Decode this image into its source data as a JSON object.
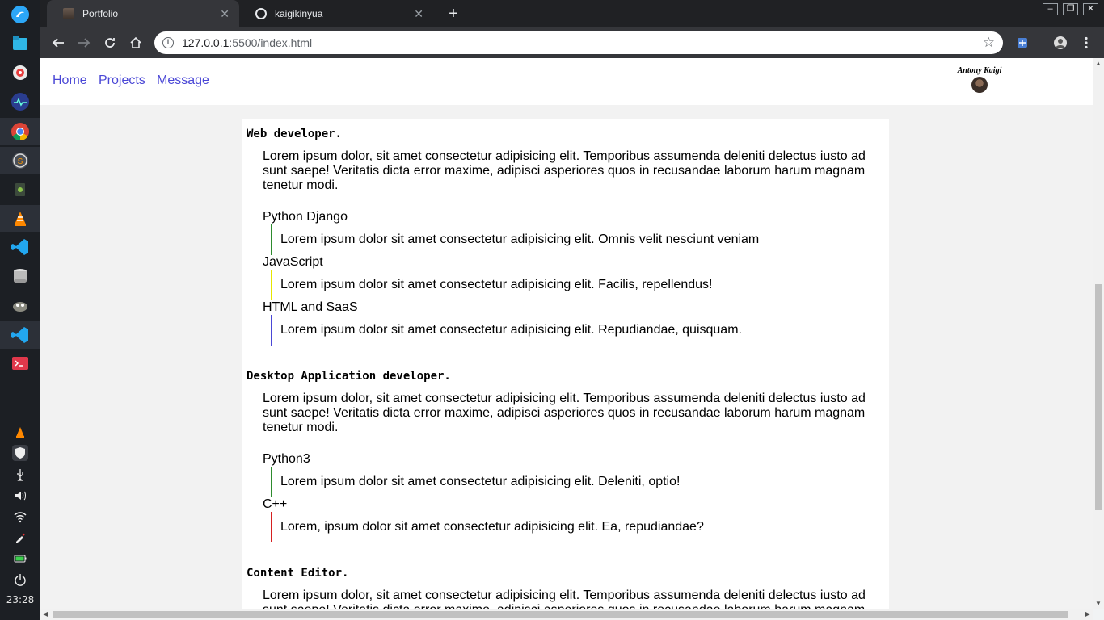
{
  "dock": {
    "apps": [
      "deepin-launcher-icon",
      "file-manager-icon",
      "settings-icon",
      "system-monitor-icon",
      "chrome-icon",
      "sublime-icon",
      "trash-icon",
      "vlc-icon",
      "vscode-icon",
      "database-icon",
      "gimp-icon",
      "vscode-icon-2",
      "terminal-icon"
    ],
    "clock": "23:28"
  },
  "browser": {
    "tabs": [
      {
        "title": "Portfolio",
        "active": true
      },
      {
        "title": "kaigikinyua",
        "active": false
      }
    ],
    "url_host": "127.0.0.1",
    "url_rest": ":5500/index.html"
  },
  "page": {
    "nav": [
      "Home",
      "Projects",
      "Message"
    ],
    "profile_name": "Antony Kaigi",
    "sections": [
      {
        "title": "Web developer.",
        "intro": "Lorem ipsum dolor, sit amet consectetur adipisicing elit. Temporibus assumenda deleniti delectus iusto ad sunt saepe! Veritatis dicta error maxime, adipisci asperiores quos in recusandae laborum harum magnam tenetur modi.",
        "skills": [
          {
            "name": "Python Django",
            "desc": "Lorem ipsum dolor sit amet consectetur adipisicing elit. Omnis velit nesciunt veniam",
            "color": "#2e8b2e"
          },
          {
            "name": "JavaScript",
            "desc": "Lorem ipsum dolor sit amet consectetur adipisicing elit. Facilis, repellendus!",
            "color": "#e6e600"
          },
          {
            "name": "HTML and SaaS",
            "desc": "Lorem ipsum dolor sit amet consectetur adipisicing elit. Repudiandae, quisquam.",
            "color": "#4a47d6"
          }
        ]
      },
      {
        "title": "Desktop Application developer.",
        "intro": "Lorem ipsum dolor, sit amet consectetur adipisicing elit. Temporibus assumenda deleniti delectus iusto ad sunt saepe! Veritatis dicta error maxime, adipisci asperiores quos in recusandae laborum harum magnam tenetur modi.",
        "skills": [
          {
            "name": "Python3",
            "desc": "Lorem ipsum dolor sit amet consectetur adipisicing elit. Deleniti, optio!",
            "color": "#2e8b2e"
          },
          {
            "name": "C++",
            "desc": "Lorem, ipsum dolor sit amet consectetur adipisicing elit. Ea, repudiandae?",
            "color": "#d62020"
          }
        ]
      },
      {
        "title": "Content Editor.",
        "intro": "Lorem ipsum dolor, sit amet consectetur adipisicing elit. Temporibus assumenda deleniti delectus iusto ad sunt saepe! Veritatis dicta error maxime, adipisci asperiores quos in recusandae laborum harum magnam tenetur modi."
      }
    ]
  }
}
